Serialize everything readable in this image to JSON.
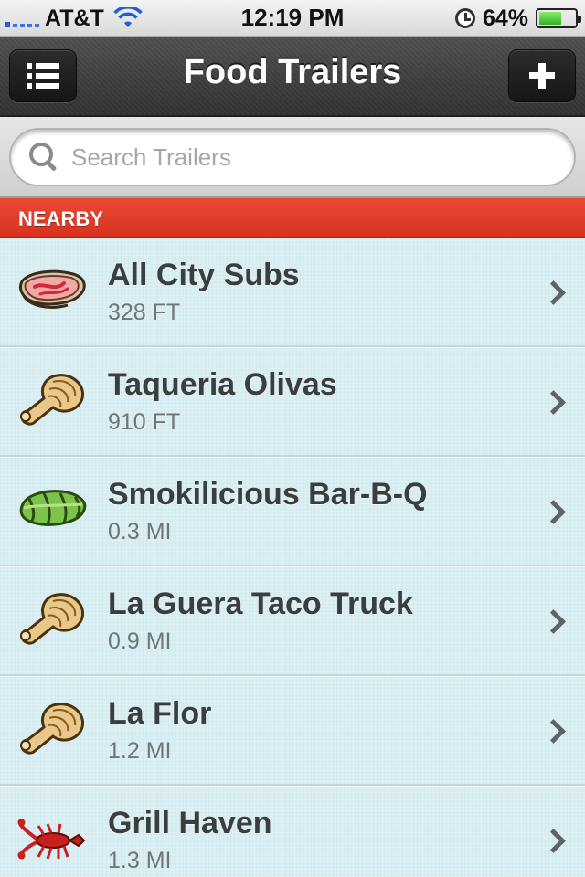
{
  "status_bar": {
    "carrier": "AT&T",
    "time": "12:19 PM",
    "battery_percent": "64%",
    "battery_level": 0.64,
    "icons": [
      "signal-icon",
      "wifi-icon",
      "clock-icon",
      "battery-icon"
    ]
  },
  "nav": {
    "title": "Food Trailers",
    "left_button_icon": "list-icon",
    "right_button_icon": "plus-icon"
  },
  "search": {
    "placeholder": "Search Trailers",
    "value": ""
  },
  "section": {
    "title": "NEARBY"
  },
  "trailers": [
    {
      "name": "All City Subs",
      "distance": "328 FT",
      "icon": "steak-icon"
    },
    {
      "name": "Taqueria Olivas",
      "distance": "910 FT",
      "icon": "drumstick-icon"
    },
    {
      "name": "Smokilicious Bar-B-Q",
      "distance": "0.3 MI",
      "icon": "burrito-icon"
    },
    {
      "name": "La Guera Taco Truck",
      "distance": "0.9 MI",
      "icon": "drumstick-icon"
    },
    {
      "name": "La Flor",
      "distance": "1.2 MI",
      "icon": "drumstick-icon"
    },
    {
      "name": "Grill Haven",
      "distance": "1.3 MI",
      "icon": "lobster-icon"
    }
  ],
  "colors": {
    "section_red": "#e23f2c",
    "nav_dark": "#3a3c3d",
    "list_bg": "#d9eef2",
    "title_text": "#3b3e40"
  }
}
